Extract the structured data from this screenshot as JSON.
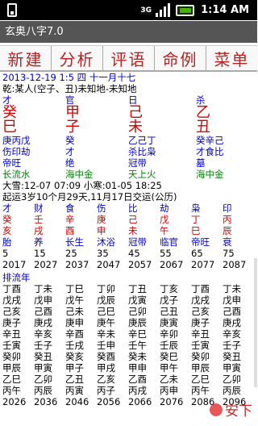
{
  "status": {
    "time": "1:14 AM",
    "network": "3G"
  },
  "app": {
    "title": "玄奥八字7.0"
  },
  "menu": [
    "新建",
    "分析",
    "评语",
    "命例",
    "菜单"
  ],
  "header": {
    "date": "2013-12-19 1:5 四 十一月十七",
    "person": "乾:某人(空子、丑)未知地-未知地"
  },
  "pillars": [
    {
      "god": "才",
      "stem": "癸",
      "branch": "巳",
      "hidden": "庚丙戊",
      "hidden_gods": "伤印劫",
      "state": "帝旺",
      "nayin": "长流水"
    },
    {
      "god": "官",
      "stem": "甲",
      "branch": "子",
      "hidden": "癸",
      "hidden_gods": "才",
      "state": "绝",
      "nayin": "海中金"
    },
    {
      "god": "日",
      "stem": "己",
      "branch": "未",
      "hidden": "乙己丁",
      "hidden_gods": "杀比枭",
      "state": "冠带",
      "nayin": "天上火"
    },
    {
      "god": "杀",
      "stem": "乙",
      "branch": "丑",
      "hidden": "癸辛己",
      "hidden_gods": "才食比",
      "state": "墓",
      "nayin": "海中金"
    }
  ],
  "solar_terms": "大雪:12-07 07:09 小寒:01-05 18:25",
  "start_luck": "起运3岁10个月29天,11月17日交运(公历)",
  "dayun": {
    "gods": [
      "才",
      "财",
      "食",
      "伤",
      "比",
      "劫",
      "枭",
      "印"
    ],
    "stems": [
      "癸",
      "壬",
      "辛",
      "庚",
      "己",
      "戊",
      "丁",
      "丙"
    ],
    "branches": [
      "亥",
      "戌",
      "酉",
      "申",
      "未",
      "午",
      "巳",
      "辰"
    ],
    "states": [
      "胎",
      "养",
      "长生",
      "沐浴",
      "冠带",
      "临官",
      "帝旺",
      "衰"
    ],
    "ages": [
      "5",
      "15",
      "25",
      "35",
      "45",
      "55",
      "65",
      "75"
    ],
    "years": [
      "2017",
      "2027",
      "2037",
      "2047",
      "2057",
      "2067",
      "2077",
      "2087"
    ]
  },
  "liunian": {
    "title": "排流年",
    "rows": [
      [
        "丁酉",
        "丁未",
        "丁巳",
        "丁卯",
        "丁丑",
        "丁亥",
        "丁酉",
        "丁未"
      ],
      [
        "戊戌",
        "戊申",
        "戊午",
        "戊辰",
        "戊寅",
        "戊子",
        "戊戌",
        "戊申"
      ],
      [
        "己亥",
        "己酉",
        "己未",
        "己巳",
        "己卯",
        "己丑",
        "己亥",
        "己酉"
      ],
      [
        "庚子",
        "庚戌",
        "庚申",
        "庚午",
        "庚辰",
        "庚寅",
        "庚子",
        "庚戌"
      ],
      [
        "辛丑",
        "辛亥",
        "辛酉",
        "辛未",
        "辛巳",
        "辛卯",
        "辛丑",
        "辛亥"
      ],
      [
        "壬寅",
        "壬子",
        "壬戌",
        "壬申",
        "壬午",
        "壬辰",
        "壬寅",
        "壬子"
      ],
      [
        "癸卯",
        "癸丑",
        "癸亥",
        "癸酉",
        "癸未",
        "癸巳",
        "癸卯",
        "癸丑"
      ],
      [
        "甲辰",
        "甲寅",
        "甲子",
        "甲戌",
        "甲申",
        "甲午",
        "甲辰",
        "甲寅"
      ],
      [
        "乙巳",
        "乙卯",
        "乙丑",
        "乙亥",
        "乙酉",
        "乙未",
        "乙巳",
        "乙卯"
      ],
      [
        "丙午",
        "丙辰",
        "丙寅",
        "丙子",
        "丙戌",
        "丙申",
        "丙午",
        "丙辰"
      ],
      [
        "2026",
        "2036",
        "2046",
        "2056",
        "2066",
        "2076",
        "2086",
        "2096"
      ]
    ]
  },
  "watermark": "安下"
}
